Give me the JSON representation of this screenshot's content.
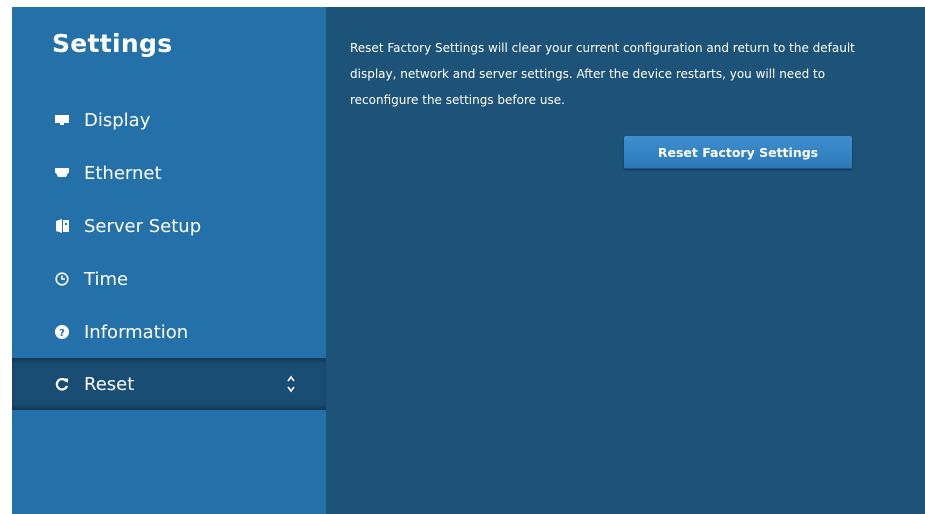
{
  "sidebar": {
    "title": "Settings",
    "items": [
      {
        "label": "Display",
        "icon": "monitor-icon"
      },
      {
        "label": "Ethernet",
        "icon": "ethernet-icon"
      },
      {
        "label": "Server Setup",
        "icon": "server-icon"
      },
      {
        "label": "Time",
        "icon": "clock-icon"
      },
      {
        "label": "Information",
        "icon": "question-circle-icon"
      },
      {
        "label": "Reset",
        "icon": "refresh-icon",
        "selected": true
      }
    ]
  },
  "main": {
    "description": "Reset Factory Settings will clear your current configuration and return to the default display, network and server settings. After the device restarts, you will need to reconfigure the settings before use.",
    "reset_button_label": "Reset Factory Settings"
  },
  "colors": {
    "sidebar_bg": "#2371a8",
    "main_bg": "#1d5279",
    "selected_bg": "#1a4d73",
    "button_bg": "#3688c8"
  }
}
